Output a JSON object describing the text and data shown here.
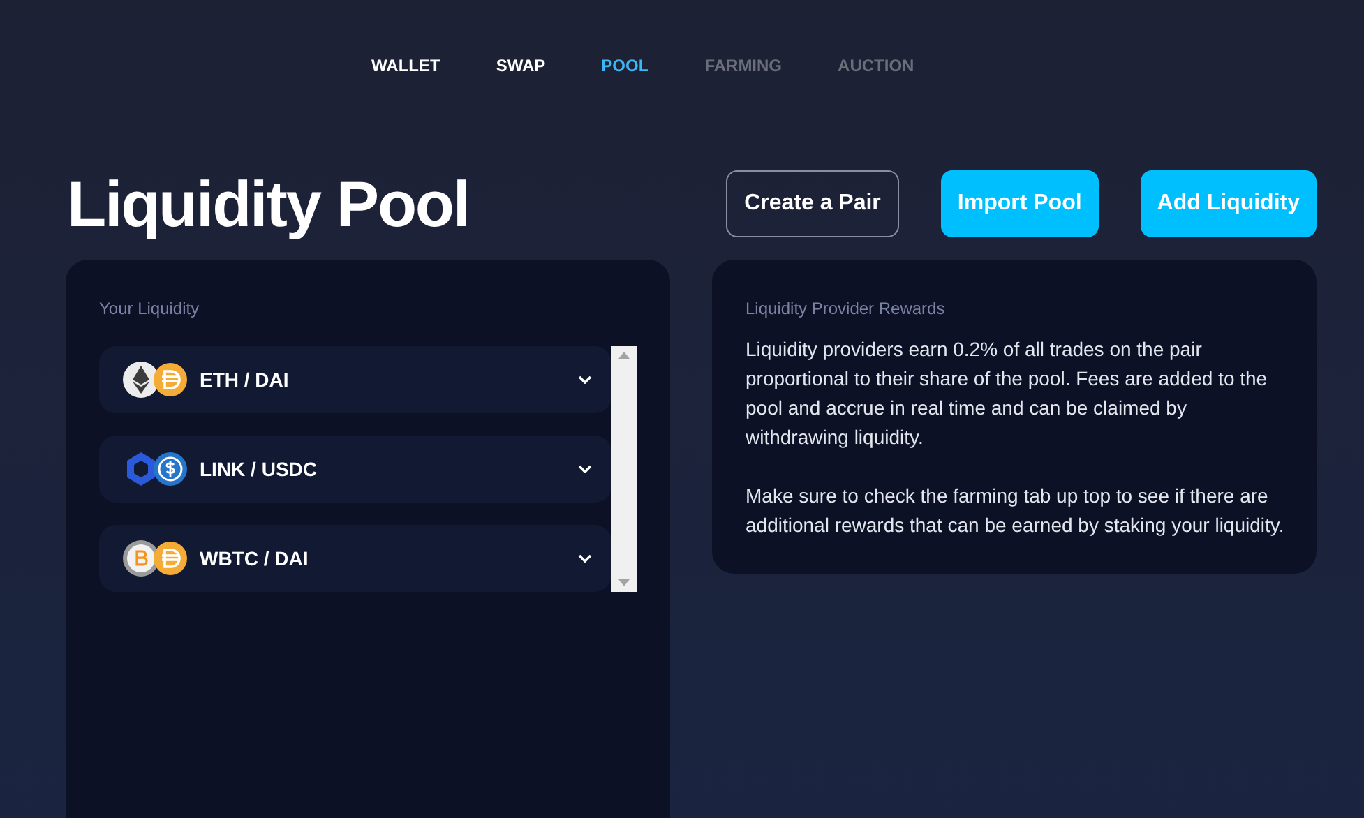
{
  "nav": [
    {
      "label": "WALLET",
      "selected": false,
      "disabled": false
    },
    {
      "label": "SWAP",
      "selected": false,
      "disabled": false
    },
    {
      "label": "POOL",
      "selected": true,
      "disabled": false
    },
    {
      "label": "FARMING",
      "selected": false,
      "disabled": true
    },
    {
      "label": "AUCTION",
      "selected": false,
      "disabled": true
    }
  ],
  "title": "Liquidity Pool",
  "actions": [
    {
      "label": "Create a Pair",
      "kind": "outline"
    },
    {
      "label": "Import Pool",
      "kind": "filled"
    },
    {
      "label": "Add Liquidity",
      "kind": "filled"
    }
  ],
  "liquidity": {
    "heading": "Your Liquidity",
    "pairs": [
      {
        "label": "ETH / DAI",
        "expanded": false
      },
      {
        "label": "LINK / USDC",
        "expanded": false
      },
      {
        "label": "WBTC / DAI",
        "expanded": false
      }
    ]
  },
  "rewards": {
    "heading": "Liquidity Provider Rewards",
    "paragraphs": [
      "Liquidity providers earn 0.2% of all trades on the pair proportional to their share of the pool. Fees are added to the pool and accrue in real time and can be claimed by withdrawing liquidity.",
      "Make sure to check the farming tab up top to see if there are additional rewards that can be earned by staking your liquidity."
    ]
  }
}
